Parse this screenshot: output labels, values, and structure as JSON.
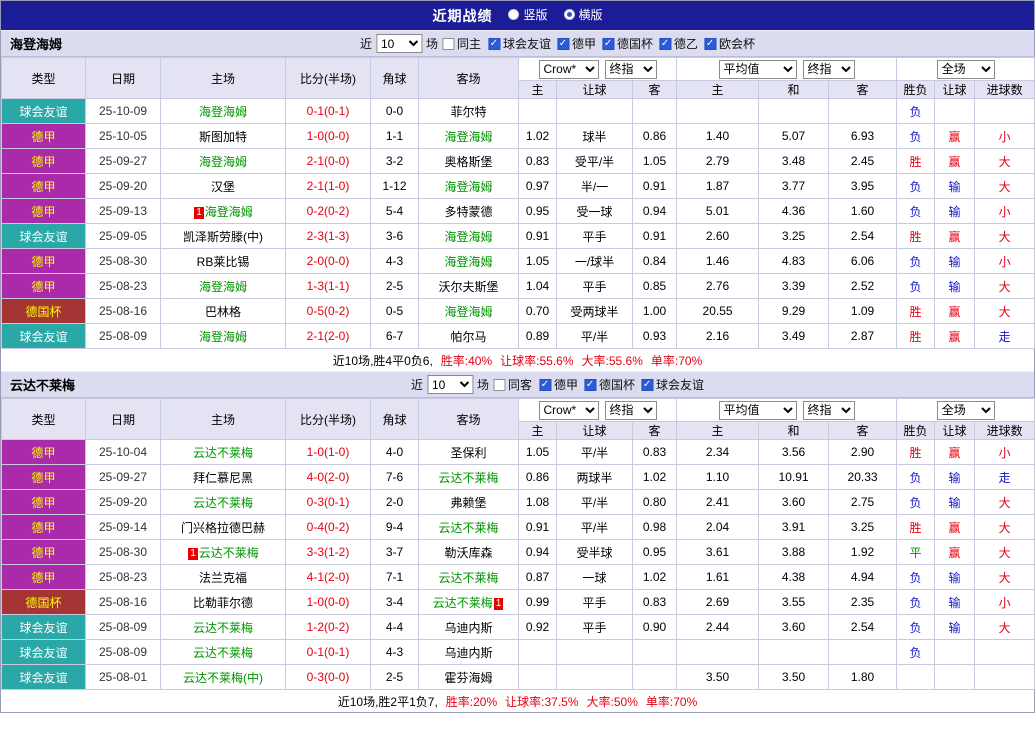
{
  "title_bar": {
    "title": "近期战绩",
    "radios": [
      {
        "label": "竖版",
        "selected": false
      },
      {
        "label": "横版",
        "selected": true
      }
    ]
  },
  "colors": {
    "title_bar_bg": "#1c1c97",
    "section_bar_bg": "#dcdcf0",
    "friendly_badge_bg": "#2aa7a7",
    "league_badge_bg": "#a92ba9",
    "cup_badge_bg": "#a53434",
    "self_team_green": "#009400",
    "win_red": "#e60012",
    "lose_blue": "#1414cc",
    "draw_green": "#009400",
    "checkbox_blue": "#2b5bd7"
  },
  "filter_labels": {
    "near": "近",
    "unit": "场"
  },
  "columns": {
    "left": [
      "类型",
      "日期",
      "主场",
      "比分(半场)",
      "角球",
      "客场"
    ],
    "asia_selects": [
      "Crow*",
      "终指"
    ],
    "asia_cols": [
      "主",
      "让球",
      "客"
    ],
    "europe_selects": [
      "平均值",
      "终指"
    ],
    "europe_cols": [
      "主",
      "和",
      "客"
    ],
    "scope_select": "全场",
    "result_cols": [
      "胜负",
      "让球",
      "进球数"
    ]
  },
  "sections": [
    {
      "team": "海登海姆",
      "filter": {
        "count": "10",
        "same": {
          "label": "同主",
          "checked": false
        },
        "leagues": [
          {
            "label": "球会友谊",
            "checked": true
          },
          {
            "label": "德甲",
            "checked": true
          },
          {
            "label": "德国杯",
            "checked": true
          },
          {
            "label": "德乙",
            "checked": true
          },
          {
            "label": "欧会杯",
            "checked": true
          }
        ]
      },
      "rows": [
        {
          "type": "球会友谊",
          "style": "friendly",
          "date": "25-10-09",
          "home": "海登海姆",
          "home_self": true,
          "home_badge": "",
          "score": "0-1(0-1)",
          "corner": "0-0",
          "away": "菲尔特",
          "away_self": false,
          "away_badge": "",
          "asia": [
            "",
            "",
            ""
          ],
          "europe": [
            "",
            "",
            ""
          ],
          "result": {
            "t": "负",
            "c": "blue"
          },
          "handicap": {
            "t": "",
            "c": "none"
          },
          "goals": {
            "t": "",
            "c": "none"
          }
        },
        {
          "type": "德甲",
          "style": "league",
          "date": "25-10-05",
          "home": "斯图加特",
          "home_self": false,
          "home_badge": "",
          "score": "1-0(0-0)",
          "corner": "1-1",
          "away": "海登海姆",
          "away_self": true,
          "away_badge": "",
          "asia": [
            "1.02",
            "球半",
            "0.86"
          ],
          "europe": [
            "1.40",
            "5.07",
            "6.93"
          ],
          "result": {
            "t": "负",
            "c": "blue"
          },
          "handicap": {
            "t": "赢",
            "c": "red"
          },
          "goals": {
            "t": "小",
            "c": "red"
          }
        },
        {
          "type": "德甲",
          "style": "league",
          "date": "25-09-27",
          "home": "海登海姆",
          "home_self": true,
          "home_badge": "",
          "score": "2-1(0-0)",
          "corner": "3-2",
          "away": "奥格斯堡",
          "away_self": false,
          "away_badge": "",
          "asia": [
            "0.83",
            "受平/半",
            "1.05"
          ],
          "europe": [
            "2.79",
            "3.48",
            "2.45"
          ],
          "result": {
            "t": "胜",
            "c": "red"
          },
          "handicap": {
            "t": "赢",
            "c": "red"
          },
          "goals": {
            "t": "大",
            "c": "red"
          }
        },
        {
          "type": "德甲",
          "style": "league",
          "date": "25-09-20",
          "home": "汉堡",
          "home_self": false,
          "home_badge": "",
          "score": "2-1(1-0)",
          "corner": "1-12",
          "away": "海登海姆",
          "away_self": true,
          "away_badge": "",
          "asia": [
            "0.97",
            "半/一",
            "0.91"
          ],
          "europe": [
            "1.87",
            "3.77",
            "3.95"
          ],
          "result": {
            "t": "负",
            "c": "blue"
          },
          "handicap": {
            "t": "输",
            "c": "blue"
          },
          "goals": {
            "t": "大",
            "c": "red"
          }
        },
        {
          "type": "德甲",
          "style": "league",
          "date": "25-09-13",
          "home": "海登海姆",
          "home_self": true,
          "home_badge": "1",
          "score": "0-2(0-2)",
          "corner": "5-4",
          "away": "多特蒙德",
          "away_self": false,
          "away_badge": "",
          "asia": [
            "0.95",
            "受一球",
            "0.94"
          ],
          "europe": [
            "5.01",
            "4.36",
            "1.60"
          ],
          "result": {
            "t": "负",
            "c": "blue"
          },
          "handicap": {
            "t": "输",
            "c": "blue"
          },
          "goals": {
            "t": "小",
            "c": "red"
          }
        },
        {
          "type": "球会友谊",
          "style": "friendly",
          "date": "25-09-05",
          "home": "凯泽斯劳滕(中)",
          "home_self": false,
          "home_badge": "",
          "score": "2-3(1-3)",
          "corner": "3-6",
          "away": "海登海姆",
          "away_self": true,
          "away_badge": "",
          "asia": [
            "0.91",
            "平手",
            "0.91"
          ],
          "europe": [
            "2.60",
            "3.25",
            "2.54"
          ],
          "result": {
            "t": "胜",
            "c": "red"
          },
          "handicap": {
            "t": "赢",
            "c": "red"
          },
          "goals": {
            "t": "大",
            "c": "red"
          }
        },
        {
          "type": "德甲",
          "style": "league",
          "date": "25-08-30",
          "home": "RB莱比锡",
          "home_self": false,
          "home_badge": "",
          "score": "2-0(0-0)",
          "corner": "4-3",
          "away": "海登海姆",
          "away_self": true,
          "away_badge": "",
          "asia": [
            "1.05",
            "一/球半",
            "0.84"
          ],
          "europe": [
            "1.46",
            "4.83",
            "6.06"
          ],
          "result": {
            "t": "负",
            "c": "blue"
          },
          "handicap": {
            "t": "输",
            "c": "blue"
          },
          "goals": {
            "t": "小",
            "c": "red"
          }
        },
        {
          "type": "德甲",
          "style": "league",
          "date": "25-08-23",
          "home": "海登海姆",
          "home_self": true,
          "home_badge": "",
          "score": "1-3(1-1)",
          "corner": "2-5",
          "away": "沃尔夫斯堡",
          "away_self": false,
          "away_badge": "",
          "asia": [
            "1.04",
            "平手",
            "0.85"
          ],
          "europe": [
            "2.76",
            "3.39",
            "2.52"
          ],
          "result": {
            "t": "负",
            "c": "blue"
          },
          "handicap": {
            "t": "输",
            "c": "blue"
          },
          "goals": {
            "t": "大",
            "c": "red"
          }
        },
        {
          "type": "德国杯",
          "style": "cup",
          "date": "25-08-16",
          "home": "巴林格",
          "home_self": false,
          "home_badge": "",
          "score": "0-5(0-2)",
          "corner": "0-5",
          "away": "海登海姆",
          "away_self": true,
          "away_badge": "",
          "asia": [
            "0.70",
            "受两球半",
            "1.00"
          ],
          "europe": [
            "20.55",
            "9.29",
            "1.09"
          ],
          "result": {
            "t": "胜",
            "c": "red"
          },
          "handicap": {
            "t": "赢",
            "c": "red"
          },
          "goals": {
            "t": "大",
            "c": "red"
          }
        },
        {
          "type": "球会友谊",
          "style": "friendly",
          "date": "25-08-09",
          "home": "海登海姆",
          "home_self": true,
          "home_badge": "",
          "score": "2-1(2-0)",
          "corner": "6-7",
          "away": "帕尔马",
          "away_self": false,
          "away_badge": "",
          "asia": [
            "0.89",
            "平/半",
            "0.93"
          ],
          "europe": [
            "2.16",
            "3.49",
            "2.87"
          ],
          "result": {
            "t": "胜",
            "c": "red"
          },
          "handicap": {
            "t": "赢",
            "c": "red"
          },
          "goals": {
            "t": "走",
            "c": "blue"
          }
        }
      ],
      "summary": {
        "record": "近10场,胜4平0负6,",
        "stats": [
          "胜率:40%",
          "让球率:55.6%",
          "大率:55.6%",
          "单率:70%"
        ]
      }
    },
    {
      "team": "云达不莱梅",
      "filter": {
        "count": "10",
        "same": {
          "label": "同客",
          "checked": false
        },
        "leagues": [
          {
            "label": "德甲",
            "checked": true
          },
          {
            "label": "德国杯",
            "checked": true
          },
          {
            "label": "球会友谊",
            "checked": true
          }
        ]
      },
      "rows": [
        {
          "type": "德甲",
          "style": "league",
          "date": "25-10-04",
          "home": "云达不莱梅",
          "home_self": true,
          "home_badge": "",
          "score": "1-0(1-0)",
          "corner": "4-0",
          "away": "圣保利",
          "away_self": false,
          "away_badge": "",
          "asia": [
            "1.05",
            "平/半",
            "0.83"
          ],
          "europe": [
            "2.34",
            "3.56",
            "2.90"
          ],
          "result": {
            "t": "胜",
            "c": "red"
          },
          "handicap": {
            "t": "赢",
            "c": "red"
          },
          "goals": {
            "t": "小",
            "c": "red"
          }
        },
        {
          "type": "德甲",
          "style": "league",
          "date": "25-09-27",
          "home": "拜仁慕尼黑",
          "home_self": false,
          "home_badge": "",
          "score": "4-0(2-0)",
          "corner": "7-6",
          "away": "云达不莱梅",
          "away_self": true,
          "away_badge": "",
          "asia": [
            "0.86",
            "两球半",
            "1.02"
          ],
          "europe": [
            "1.10",
            "10.91",
            "20.33"
          ],
          "result": {
            "t": "负",
            "c": "blue"
          },
          "handicap": {
            "t": "输",
            "c": "blue"
          },
          "goals": {
            "t": "走",
            "c": "blue"
          }
        },
        {
          "type": "德甲",
          "style": "league",
          "date": "25-09-20",
          "home": "云达不莱梅",
          "home_self": true,
          "home_badge": "",
          "score": "0-3(0-1)",
          "corner": "2-0",
          "away": "弗赖堡",
          "away_self": false,
          "away_badge": "",
          "asia": [
            "1.08",
            "平/半",
            "0.80"
          ],
          "europe": [
            "2.41",
            "3.60",
            "2.75"
          ],
          "result": {
            "t": "负",
            "c": "blue"
          },
          "handicap": {
            "t": "输",
            "c": "blue"
          },
          "goals": {
            "t": "大",
            "c": "red"
          }
        },
        {
          "type": "德甲",
          "style": "league",
          "date": "25-09-14",
          "home": "门兴格拉德巴赫",
          "home_self": false,
          "home_badge": "",
          "score": "0-4(0-2)",
          "corner": "9-4",
          "away": "云达不莱梅",
          "away_self": true,
          "away_badge": "",
          "asia": [
            "0.91",
            "平/半",
            "0.98"
          ],
          "europe": [
            "2.04",
            "3.91",
            "3.25"
          ],
          "result": {
            "t": "胜",
            "c": "red"
          },
          "handicap": {
            "t": "赢",
            "c": "red"
          },
          "goals": {
            "t": "大",
            "c": "red"
          }
        },
        {
          "type": "德甲",
          "style": "league",
          "date": "25-08-30",
          "home": "云达不莱梅",
          "home_self": true,
          "home_badge": "1",
          "score": "3-3(1-2)",
          "corner": "3-7",
          "away": "勒沃库森",
          "away_self": false,
          "away_badge": "",
          "asia": [
            "0.94",
            "受半球",
            "0.95"
          ],
          "europe": [
            "3.61",
            "3.88",
            "1.92"
          ],
          "result": {
            "t": "平",
            "c": "green"
          },
          "handicap": {
            "t": "赢",
            "c": "red"
          },
          "goals": {
            "t": "大",
            "c": "red"
          }
        },
        {
          "type": "德甲",
          "style": "league",
          "date": "25-08-23",
          "home": "法兰克福",
          "home_self": false,
          "home_badge": "",
          "score": "4-1(2-0)",
          "corner": "7-1",
          "away": "云达不莱梅",
          "away_self": true,
          "away_badge": "",
          "asia": [
            "0.87",
            "一球",
            "1.02"
          ],
          "europe": [
            "1.61",
            "4.38",
            "4.94"
          ],
          "result": {
            "t": "负",
            "c": "blue"
          },
          "handicap": {
            "t": "输",
            "c": "blue"
          },
          "goals": {
            "t": "大",
            "c": "red"
          }
        },
        {
          "type": "德国杯",
          "style": "cup",
          "date": "25-08-16",
          "home": "比勒菲尔德",
          "home_self": false,
          "home_badge": "",
          "score": "1-0(0-0)",
          "corner": "3-4",
          "away": "云达不莱梅",
          "away_self": true,
          "away_badge": "1",
          "asia": [
            "0.99",
            "平手",
            "0.83"
          ],
          "europe": [
            "2.69",
            "3.55",
            "2.35"
          ],
          "result": {
            "t": "负",
            "c": "blue"
          },
          "handicap": {
            "t": "输",
            "c": "blue"
          },
          "goals": {
            "t": "小",
            "c": "red"
          }
        },
        {
          "type": "球会友谊",
          "style": "friendly",
          "date": "25-08-09",
          "home": "云达不莱梅",
          "home_self": true,
          "home_badge": "",
          "score": "1-2(0-2)",
          "corner": "4-4",
          "away": "乌迪内斯",
          "away_self": false,
          "away_badge": "",
          "asia": [
            "0.92",
            "平手",
            "0.90"
          ],
          "europe": [
            "2.44",
            "3.60",
            "2.54"
          ],
          "result": {
            "t": "负",
            "c": "blue"
          },
          "handicap": {
            "t": "输",
            "c": "blue"
          },
          "goals": {
            "t": "大",
            "c": "red"
          }
        },
        {
          "type": "球会友谊",
          "style": "friendly",
          "date": "25-08-09",
          "home": "云达不莱梅",
          "home_self": true,
          "home_badge": "",
          "score": "0-1(0-1)",
          "corner": "4-3",
          "away": "乌迪内斯",
          "away_self": false,
          "away_badge": "",
          "asia": [
            "",
            "",
            ""
          ],
          "europe": [
            "",
            "",
            ""
          ],
          "result": {
            "t": "负",
            "c": "blue"
          },
          "handicap": {
            "t": "",
            "c": "none"
          },
          "goals": {
            "t": "",
            "c": "none"
          }
        },
        {
          "type": "球会友谊",
          "style": "friendly",
          "date": "25-08-01",
          "home": "云达不莱梅(中)",
          "home_self": true,
          "home_badge": "",
          "score": "0-3(0-0)",
          "corner": "2-5",
          "away": "霍芬海姆",
          "away_self": false,
          "away_badge": "",
          "asia": [
            "",
            "",
            ""
          ],
          "europe": [
            "3.50",
            "3.50",
            "1.80"
          ],
          "result": {
            "t": "",
            "c": "none"
          },
          "handicap": {
            "t": "",
            "c": "none"
          },
          "goals": {
            "t": "",
            "c": "none"
          }
        }
      ],
      "summary": {
        "record": "近10场,胜2平1负7,",
        "stats": [
          "胜率:20%",
          "让球率:37.5%",
          "大率:50%",
          "单率:70%"
        ]
      }
    }
  ]
}
